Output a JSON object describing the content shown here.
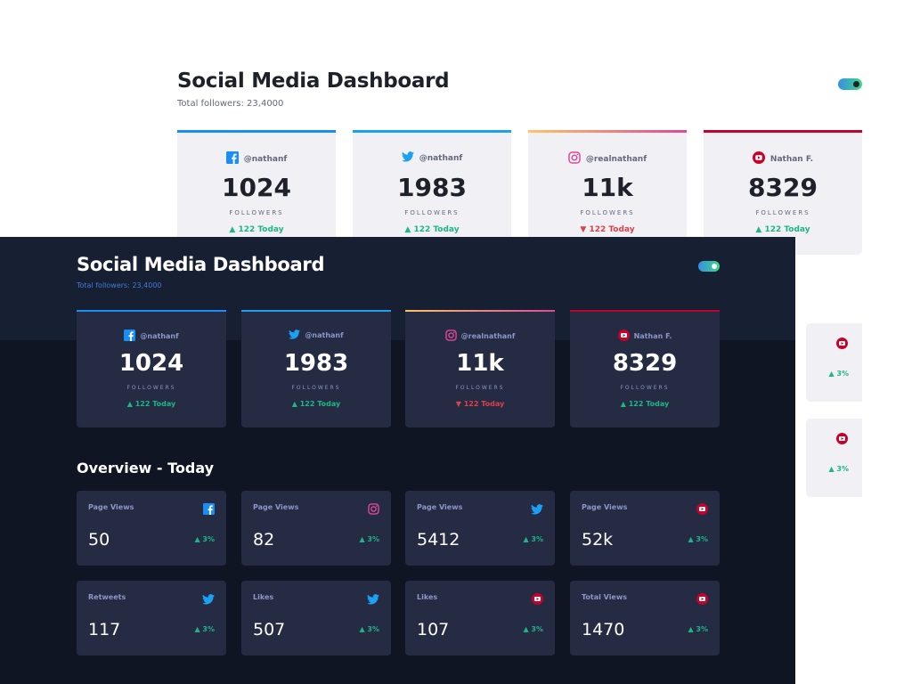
{
  "light": {
    "title": "Social Media Dashboard",
    "subtitle": "Total followers: 23,4000",
    "cards": [
      {
        "network": "facebook-icon",
        "handle": "@nathanf",
        "count": "1024",
        "label": "FOLLOWERS",
        "today": "▲ 122 Today",
        "trend": "up",
        "accent": "#198ff5"
      },
      {
        "network": "twitter-icon",
        "handle": "@nathanf",
        "count": "1983",
        "label": "FOLLOWERS",
        "today": "▲ 122 Today",
        "trend": "up",
        "accent": "#1ca0f2"
      },
      {
        "network": "instagram-icon",
        "handle": "@realnathanf",
        "count": "11k",
        "label": "FOLLOWERS",
        "today": "▼ 122 Today",
        "trend": "down",
        "accent": "#df4996"
      },
      {
        "network": "youtube-icon",
        "handle": "Nathan F.",
        "count": "8329",
        "label": "FOLLOWERS",
        "today": "▲ 122 Today",
        "trend": "up",
        "accent": "#c4032a"
      }
    ],
    "side_cards": [
      {
        "icon": "youtube-icon",
        "pct": "▲ 3%"
      },
      {
        "icon": "youtube-icon",
        "pct": "▲ 3%"
      }
    ]
  },
  "dark": {
    "title": "Social Media Dashboard",
    "subtitle": "Total followers: 23,4000",
    "cards": [
      {
        "network": "facebook-icon",
        "handle": "@nathanf",
        "count": "1024",
        "label": "FOLLOWERS",
        "today": "▲ 122 Today",
        "trend": "up",
        "accent": "#198ff5"
      },
      {
        "network": "twitter-icon",
        "handle": "@nathanf",
        "count": "1983",
        "label": "FOLLOWERS",
        "today": "▲ 122 Today",
        "trend": "up",
        "accent": "#1ca0f2"
      },
      {
        "network": "instagram-icon",
        "handle": "@realnathanf",
        "count": "11k",
        "label": "FOLLOWERS",
        "today": "▼ 122 Today",
        "trend": "down",
        "accent": "#df4996"
      },
      {
        "network": "youtube-icon",
        "handle": "Nathan F.",
        "count": "8329",
        "label": "FOLLOWERS",
        "today": "▲ 122 Today",
        "trend": "up",
        "accent": "#c4032a"
      }
    ],
    "overview_title": "Overview - Today",
    "overview": [
      {
        "label": "Page Views",
        "icon": "facebook-icon",
        "value": "50",
        "pct": "▲ 3%"
      },
      {
        "label": "Page Views",
        "icon": "instagram-icon",
        "value": "82",
        "pct": "▲ 3%"
      },
      {
        "label": "Page Views",
        "icon": "twitter-icon",
        "value": "5412",
        "pct": "▲ 3%"
      },
      {
        "label": "Page Views",
        "icon": "youtube-icon",
        "value": "52k",
        "pct": "▲ 3%"
      },
      {
        "label": "Retweets",
        "icon": "twitter-icon",
        "value": "117",
        "pct": "▲ 3%"
      },
      {
        "label": "Likes",
        "icon": "twitter-icon",
        "value": "507",
        "pct": "▲ 3%"
      },
      {
        "label": "Likes",
        "icon": "youtube-icon",
        "value": "107",
        "pct": "▲ 3%"
      },
      {
        "label": "Total Views",
        "icon": "youtube-icon",
        "value": "1470",
        "pct": "▲ 3%"
      }
    ]
  },
  "colors": {
    "up": "#1eb589",
    "down": "#dc414c",
    "facebook": "#198ff5",
    "twitter": "#1ca0f2",
    "instagram": "#df4996",
    "youtube": "#c4032a"
  }
}
